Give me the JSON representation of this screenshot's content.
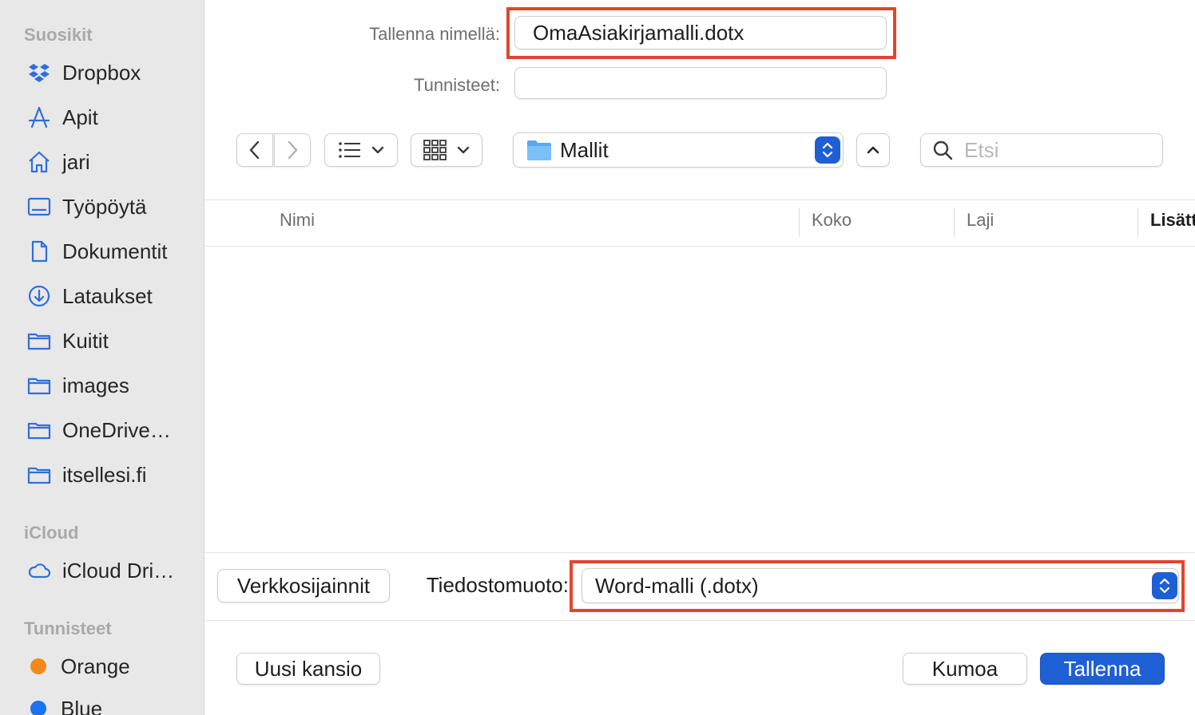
{
  "sidebar": {
    "sections": {
      "favorites": "Suosikit",
      "icloud": "iCloud",
      "tags": "Tunnisteet"
    },
    "favorites": [
      {
        "label": "Dropbox",
        "icon": "dropbox-icon"
      },
      {
        "label": "Apit",
        "icon": "applications-icon"
      },
      {
        "label": "jari",
        "icon": "home-icon"
      },
      {
        "label": "Työpöytä",
        "icon": "desktop-icon"
      },
      {
        "label": "Dokumentit",
        "icon": "document-icon"
      },
      {
        "label": "Lataukset",
        "icon": "download-icon"
      },
      {
        "label": "Kuitit",
        "icon": "folder-icon"
      },
      {
        "label": "images",
        "icon": "folder-icon"
      },
      {
        "label": "OneDrive…",
        "icon": "folder-icon"
      },
      {
        "label": "itsellesi.fi",
        "icon": "folder-icon"
      }
    ],
    "icloud": [
      {
        "label": "iCloud Dri…",
        "icon": "cloud-icon"
      }
    ],
    "tags": [
      {
        "label": "Orange",
        "color": "#f08a1c"
      },
      {
        "label": "Blue",
        "color": "#1a73f0"
      }
    ]
  },
  "form": {
    "save_as_label": "Tallenna nimellä:",
    "save_as_value": "OmaAsiakirjamalli.dotx",
    "tags_label": "Tunnisteet:",
    "tags_value": ""
  },
  "toolbar": {
    "location": "Mallit",
    "search_placeholder": "Etsi"
  },
  "table": {
    "columns": [
      "Nimi",
      "Koko",
      "Laji",
      "Lisätt"
    ]
  },
  "bottom": {
    "network_button": "Verkkosijainnit",
    "format_label": "Tiedostomuoto:",
    "format_value": "Word-malli (.dotx)"
  },
  "footer": {
    "new_folder": "Uusi kansio",
    "cancel": "Kumoa",
    "save": "Tallenna"
  },
  "colors": {
    "accent": "#1f5fd6",
    "highlight": "#e4442d",
    "sidebar_icon": "#2f6fdc"
  }
}
